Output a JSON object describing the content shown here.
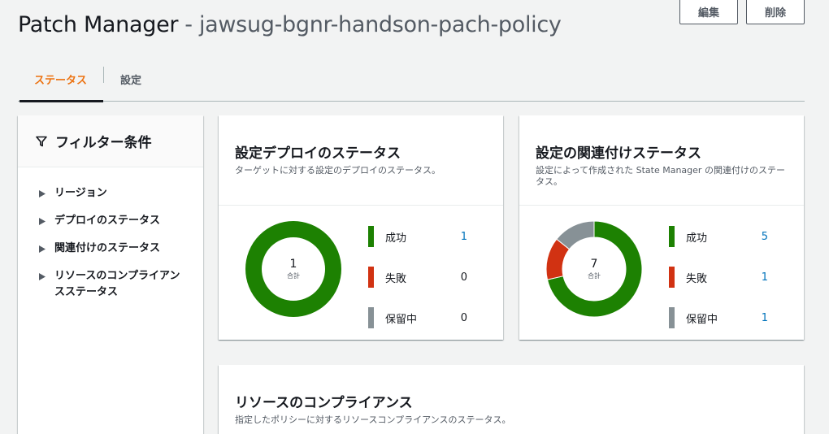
{
  "header": {
    "title": "Patch Manager",
    "separator": "-",
    "subtitle": "jawsug-bgnr-handson-pach-policy",
    "edit_label": "編集",
    "delete_label": "削除"
  },
  "tabs": [
    {
      "label": "ステータス",
      "active": true
    },
    {
      "label": "設定",
      "active": false
    }
  ],
  "filters": {
    "title": "フィルター条件",
    "items": [
      {
        "label": "リージョン"
      },
      {
        "label": "デプロイのステータス"
      },
      {
        "label": "関連付けのステータス"
      },
      {
        "label": "リソースのコンプライアンスステータス"
      }
    ]
  },
  "deploy_status": {
    "title": "設定デプロイのステータス",
    "description": "ターゲットに対する設定のデプロイのステータス。",
    "total": "1",
    "total_label": "合計",
    "legend": [
      {
        "label": "成功",
        "value": "1",
        "color": "#1d8102",
        "link": true
      },
      {
        "label": "失敗",
        "value": "0",
        "color": "#d13212",
        "link": false
      },
      {
        "label": "保留中",
        "value": "0",
        "color": "#879196",
        "link": false
      }
    ]
  },
  "association_status": {
    "title": "設定の関連付けステータス",
    "description": "設定によって作成された State Manager の関連付けのステータス。",
    "total": "7",
    "total_label": "合計",
    "legend": [
      {
        "label": "成功",
        "value": "5",
        "color": "#1d8102",
        "link": true
      },
      {
        "label": "失敗",
        "value": "1",
        "color": "#d13212",
        "link": true
      },
      {
        "label": "保留中",
        "value": "1",
        "color": "#879196",
        "link": true
      }
    ]
  },
  "compliance": {
    "title": "リソースのコンプライアンス",
    "description": "指定したポリシーに対するリソースコンプライアンスのステータス。"
  },
  "chart_data": [
    {
      "type": "pie",
      "title": "設定デプロイのステータス",
      "categories": [
        "成功",
        "失敗",
        "保留中"
      ],
      "values": [
        1,
        0,
        0
      ],
      "colors": [
        "#1d8102",
        "#d13212",
        "#879196"
      ]
    },
    {
      "type": "pie",
      "title": "設定の関連付けステータス",
      "categories": [
        "成功",
        "失敗",
        "保留中"
      ],
      "values": [
        5,
        1,
        1
      ],
      "colors": [
        "#1d8102",
        "#d13212",
        "#879196"
      ]
    }
  ]
}
